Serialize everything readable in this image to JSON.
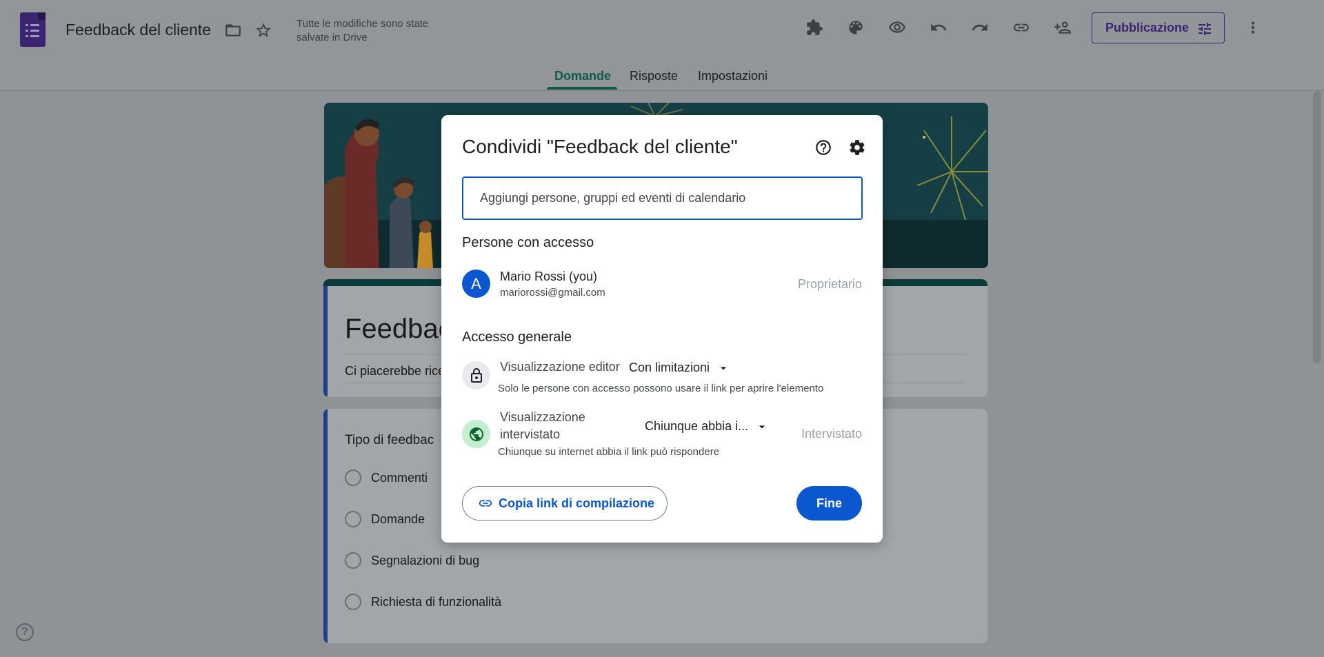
{
  "header": {
    "doc_title": "Feedback del cliente",
    "save_status": "Tutte le modifiche sono state salvate in Drive",
    "publish_label": "Pubblicazione",
    "icons": [
      "folder-icon",
      "star-icon",
      "addon-icon",
      "palette-icon",
      "preview-icon",
      "undo-icon",
      "redo-icon",
      "link-icon",
      "add-person-icon",
      "more-icon"
    ]
  },
  "tabs": [
    {
      "label": "Domande",
      "active": true
    },
    {
      "label": "Risposte",
      "active": false
    },
    {
      "label": "Impostazioni",
      "active": false
    }
  ],
  "form": {
    "heading_visible": "Feedbac",
    "description_visible": "Ci piacerebbe rice",
    "question_title_visible": "Tipo di feedbac",
    "options": [
      "Commenti",
      "Domande",
      "Segnalazioni di bug",
      "Richiesta di funzionalità"
    ]
  },
  "dialog": {
    "title": "Condividi \"Feedback del cliente\"",
    "add_placeholder": "Aggiungi persone, gruppi ed eventi di calendario",
    "people_heading": "Persone con accesso",
    "user": {
      "initial": "A",
      "name": "Mario Rossi (you)",
      "email": "mariorossi@gmail.com",
      "role": "Proprietario"
    },
    "general_heading": "Accesso generale",
    "editor_access": {
      "label": "Visualizzazione editor",
      "value": "Con limitazioni",
      "description": "Solo le persone con accesso possono usare il link per aprire l'elemento"
    },
    "responder_access": {
      "label_line1": "Visualizzazione",
      "label_line2": "intervistato",
      "value": "Chiunque abbia i...",
      "description": "Chiunque su internet abbia il link può rispondere",
      "role": "Intervistato"
    },
    "copy_link_label": "Copia link di compilazione",
    "done_label": "Fine"
  },
  "colors": {
    "accent_blue": "#0b57d0",
    "forms_purple": "#3b2470",
    "tab_active": "#0e5a4d"
  }
}
